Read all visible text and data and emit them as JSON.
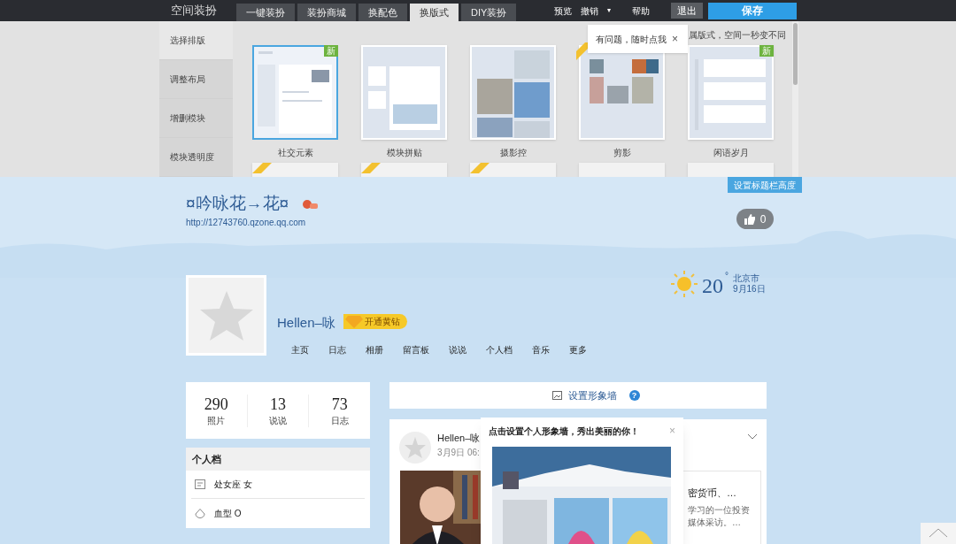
{
  "toolbar": {
    "title": "空间装扮",
    "tabs": [
      {
        "label": "一键装扮",
        "selected": false
      },
      {
        "label": "装扮商城",
        "selected": false
      },
      {
        "label": "换配色",
        "selected": false
      },
      {
        "label": "换版式",
        "selected": true
      },
      {
        "label": "DIY装扮",
        "selected": false
      }
    ],
    "actions": [
      "预览",
      "撤销"
    ],
    "caret": "▾",
    "help": "帮助",
    "exit": "退出",
    "save": "保存"
  },
  "panel": {
    "sidebar": [
      {
        "label": "选择排版",
        "selected": true
      },
      {
        "label": "调整布局",
        "selected": false
      },
      {
        "label": "增删模块",
        "selected": false
      },
      {
        "label": "模块透明度",
        "selected": false
      }
    ],
    "hint": "属版式，空间一秒变不同",
    "tooltip": {
      "text": "有问题，随时点我",
      "close": "×"
    },
    "layouts": [
      {
        "label": "社交元素",
        "badge": "新",
        "ribbon": false,
        "selected": true
      },
      {
        "label": "模块拼贴",
        "ribbon": false,
        "selected": false
      },
      {
        "label": "摄影控",
        "ribbon": false,
        "selected": false
      },
      {
        "label": "剪影",
        "ribbon": true,
        "selected": false
      },
      {
        "label": "闲语岁月",
        "badge": "新",
        "ribbon": false,
        "selected": false
      }
    ],
    "next_row": [
      {
        "ribbon": true
      },
      {
        "ribbon": true
      },
      {
        "ribbon": true
      },
      {
        "ribbon": false
      },
      {
        "ribbon": false
      }
    ]
  },
  "header": {
    "set_title_height": "设置标题栏高度",
    "title": "¤吟咏花→花¤",
    "url": "http://12743760.qzone.qq.com",
    "likes": "0"
  },
  "profile": {
    "name": "Hellen–咏",
    "vip": "开通黄钻",
    "weather": {
      "temp": "20",
      "unit": "°",
      "city": "北京市",
      "date": "9月16日"
    },
    "nav": [
      "主页",
      "日志",
      "相册",
      "留言板",
      "说说",
      "个人档",
      "音乐",
      "更多"
    ]
  },
  "stats": [
    {
      "value": "290",
      "label": "照片"
    },
    {
      "value": "13",
      "label": "说说"
    },
    {
      "value": "73",
      "label": "日志"
    }
  ],
  "profile_card": {
    "title": "个人档",
    "rows": [
      {
        "kind": "sign",
        "text": "处女座 女"
      },
      {
        "kind": "blood",
        "text": "血型 O"
      }
    ]
  },
  "wall": {
    "label": "设置形象墙",
    "help": "?"
  },
  "feed": {
    "author": "Hellen–咏",
    "time": "3月9日 06:",
    "lines": [
      "密货币、…",
      "学习的一位投资",
      "媒体采访。…"
    ]
  },
  "popup": {
    "text": "点击设置个人形象墙，秀出美丽的你！",
    "close": "×"
  }
}
